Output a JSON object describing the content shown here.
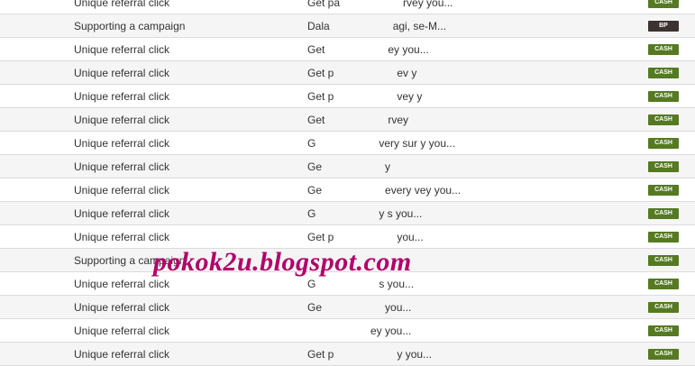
{
  "rows": [
    {
      "activity": "Unique referral click",
      "details": "Get pa",
      "details_end": "rvey you...",
      "badge": "CASH",
      "badge_type": "cash"
    },
    {
      "activity": "Supporting a campaign",
      "details": "Dala",
      "details_end": "agi, se-M...",
      "badge": "BP",
      "badge_type": "bp"
    },
    {
      "activity": "Unique referral click",
      "details": "Get",
      "details_end": "ey you...",
      "badge": "CASH",
      "badge_type": "cash"
    },
    {
      "activity": "Unique referral click",
      "details": "Get p",
      "details_end": "ev y",
      "badge": "CASH",
      "badge_type": "cash"
    },
    {
      "activity": "Unique referral click",
      "details": "Get p",
      "details_end": "vey y",
      "badge": "CASH",
      "badge_type": "cash"
    },
    {
      "activity": "Unique referral click",
      "details": "Get",
      "details_end": "rvey",
      "badge": "CASH",
      "badge_type": "cash"
    },
    {
      "activity": "Unique referral click",
      "details": "G",
      "details_end": "very sur y you...",
      "badge": "CASH",
      "badge_type": "cash"
    },
    {
      "activity": "Unique referral click",
      "details": "Ge",
      "details_end": "y",
      "badge": "CASH",
      "badge_type": "cash"
    },
    {
      "activity": "Unique referral click",
      "details": "Ge",
      "details_end": "every  vey you...",
      "badge": "CASH",
      "badge_type": "cash"
    },
    {
      "activity": "Unique referral click",
      "details": "G",
      "details_end": "y s  you...",
      "badge": "CASH",
      "badge_type": "cash"
    },
    {
      "activity": "Unique referral click",
      "details": "Get p",
      "details_end": "you...",
      "badge": "CASH",
      "badge_type": "cash"
    },
    {
      "activity": "Supporting a campaign",
      "details": "",
      "details_end": "",
      "badge": "CASH",
      "badge_type": "cash"
    },
    {
      "activity": "Unique referral click",
      "details": "G",
      "details_end": "s  you...",
      "badge": "CASH",
      "badge_type": "cash"
    },
    {
      "activity": "Unique referral click",
      "details": "Ge",
      "details_end": "you...",
      "badge": "CASH",
      "badge_type": "cash"
    },
    {
      "activity": "Unique referral click",
      "details": "",
      "details_end": "ey you...",
      "badge": "CASH",
      "badge_type": "cash"
    },
    {
      "activity": "Unique referral click",
      "details": "Get p",
      "details_end": "y you...",
      "badge": "CASH",
      "badge_type": "cash"
    }
  ],
  "watermark": "pokok2u.blogspot.com",
  "colors": {
    "cash": "#557a22",
    "bp": "#3b3331",
    "watermark": "#b0006a"
  }
}
